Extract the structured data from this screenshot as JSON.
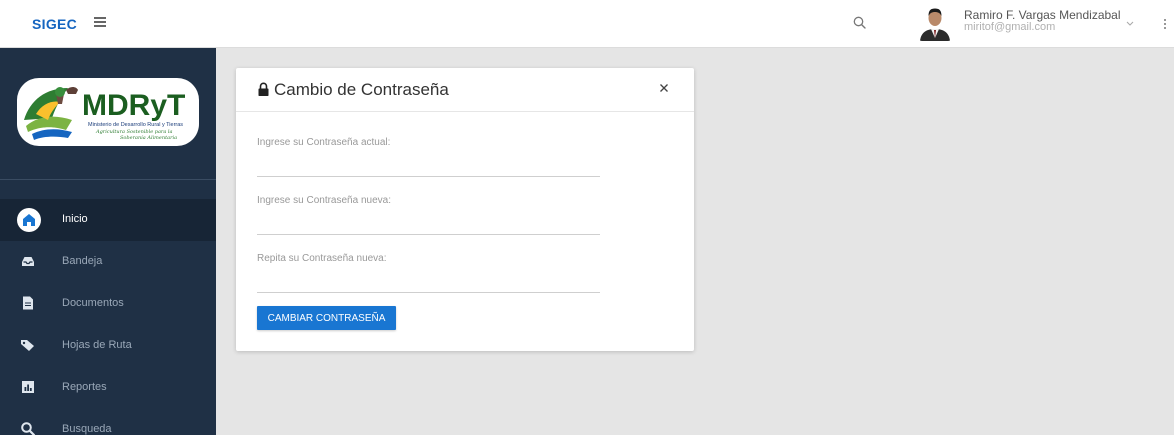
{
  "app": {
    "brand": "SIGEC"
  },
  "header": {
    "user_name": "Ramiro F. Vargas Mendizabal",
    "user_email": "miritof@gmail.com"
  },
  "sidebar": {
    "logo_text": "MDRyT",
    "logo_subtitle": "Ministerio de Desarrollo Rural y Tierras",
    "logo_tagline_1": "Agricultura Sostenible para la",
    "logo_tagline_2": "Soberanía Alimentaria",
    "items": [
      {
        "label": "Inicio",
        "icon": "home-icon",
        "active": true
      },
      {
        "label": "Bandeja",
        "icon": "inbox-icon",
        "active": false
      },
      {
        "label": "Documentos",
        "icon": "document-icon",
        "active": false
      },
      {
        "label": "Hojas de Ruta",
        "icon": "tags-icon",
        "active": false
      },
      {
        "label": "Reportes",
        "icon": "bar-chart-icon",
        "active": false
      },
      {
        "label": "Busqueda",
        "icon": "search-icon",
        "active": false
      }
    ]
  },
  "modal": {
    "title": "Cambio de Contraseña",
    "fields": [
      {
        "label": "Ingrese su Contraseña actual:",
        "value": ""
      },
      {
        "label": "Ingrese su Contraseña nueva:",
        "value": ""
      },
      {
        "label": "Repita su Contraseña nueva:",
        "value": ""
      }
    ],
    "submit_label": "CAMBIAR CONTRASEÑA"
  },
  "colors": {
    "brand": "#1565c0",
    "sidebar_bg": "#1f3045",
    "primary_button": "#1976d2",
    "page_bg": "#e5e5e5"
  }
}
